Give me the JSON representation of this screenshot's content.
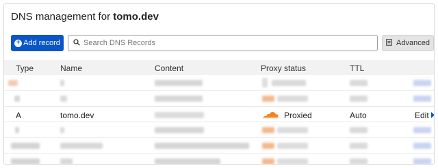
{
  "header": {
    "title_prefix": "DNS management for",
    "domain": "tomo.dev"
  },
  "toolbar": {
    "add_label": "Add record",
    "search_placeholder": "Search DNS Records",
    "advanced_label": "Advanced"
  },
  "table": {
    "columns": [
      "Type",
      "Name",
      "Content",
      "Proxy status",
      "TTL"
    ],
    "visible_row": {
      "type": "A",
      "name": "tomo.dev",
      "proxy_status": "Proxied",
      "ttl": "Auto",
      "action": "Edit"
    }
  },
  "colors": {
    "primary": "#0a55c7",
    "proxy_orange": "#f6821f"
  }
}
